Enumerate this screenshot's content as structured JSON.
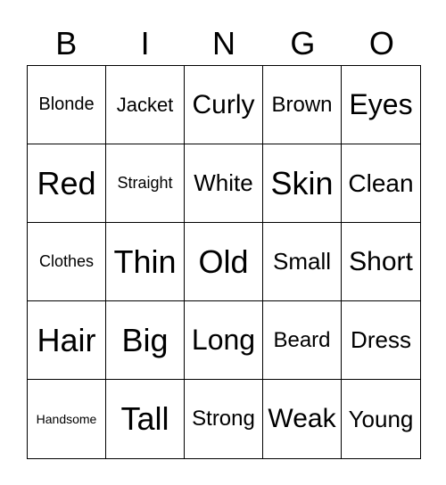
{
  "header": [
    "B",
    "I",
    "N",
    "G",
    "O"
  ],
  "cells": [
    "Blonde",
    "Jacket",
    "Curly",
    "Brown",
    "Eyes",
    "Red",
    "Straight",
    "White",
    "Skin",
    "Clean",
    "Clothes",
    "Thin",
    "Old",
    "Small",
    "Short",
    "Hair",
    "Big",
    "Long",
    "Beard",
    "Dress",
    "Handsome",
    "Tall",
    "Strong",
    "Weak",
    "Young"
  ]
}
